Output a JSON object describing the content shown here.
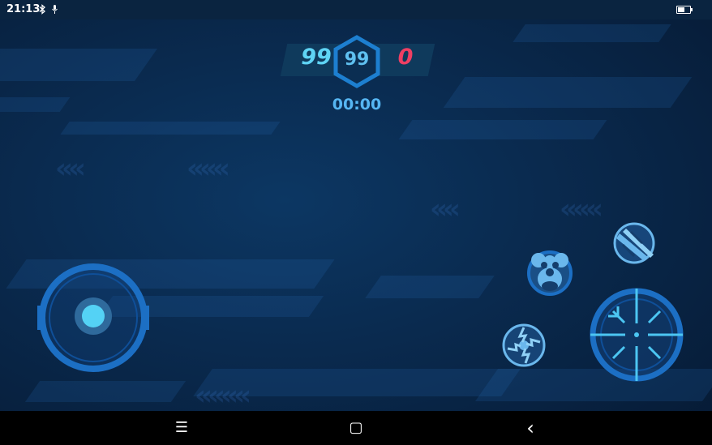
{
  "status_bar": {
    "time": "21:13",
    "icons": [
      "bluetooth-icon",
      "mic-icon",
      "battery-icon"
    ],
    "battery_level": 0.55
  },
  "scoreboard": {
    "left_score": "99",
    "center_score": "99",
    "right_score": "0",
    "timer": "00:00",
    "colors": {
      "left": "#5fd4f5",
      "center": "#5fc0f0",
      "right": "#ef3f63",
      "hex_border": "#1d7fd0"
    }
  },
  "controls": {
    "joystick": "joystick-icon",
    "skills": [
      "monkey-skill-icon",
      "slash-skill-icon",
      "lightning-skill-icon"
    ],
    "fire": "crosshair-icon",
    "accent": "#1c6fc4",
    "glow": "#4cc6f2"
  },
  "nav_bar": {
    "menu_symbol": "☰",
    "home_symbol": "▢",
    "back_symbol": "‹"
  }
}
